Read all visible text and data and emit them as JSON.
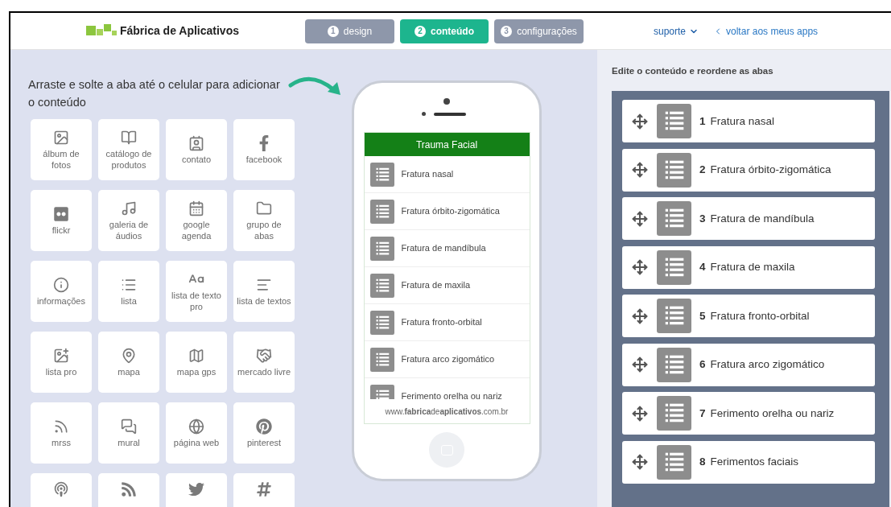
{
  "header": {
    "brand": "Fábrica de Aplicativos",
    "steps": [
      {
        "number": "1",
        "label": "design",
        "selected": false
      },
      {
        "number": "2",
        "label": "conteúdo",
        "selected": true
      },
      {
        "number": "3",
        "label": "configurações",
        "selected": false
      }
    ],
    "support": "suporte",
    "back_link": "voltar aos meus apps"
  },
  "instructions": "Arraste e solte a aba até o celular para adicionar o conteúdo",
  "tiles": [
    {
      "label": "álbum de fotos"
    },
    {
      "label": "catálogo de produtos"
    },
    {
      "label": "contato"
    },
    {
      "label": "facebook"
    },
    {
      "label": "flickr"
    },
    {
      "label": "galeria de áudios"
    },
    {
      "label": "google agenda"
    },
    {
      "label": "grupo de abas"
    },
    {
      "label": "informações"
    },
    {
      "label": "lista"
    },
    {
      "label": "lista de texto pro"
    },
    {
      "label": "lista de textos"
    },
    {
      "label": "lista pro"
    },
    {
      "label": "mapa"
    },
    {
      "label": "mapa gps"
    },
    {
      "label": "mercado livre"
    },
    {
      "label": "mrss"
    },
    {
      "label": "mural"
    },
    {
      "label": "página web"
    },
    {
      "label": "pinterest"
    }
  ],
  "phone": {
    "title": "Trauma Facial",
    "items": [
      "Fratura nasal",
      "Fratura órbito-zigomática",
      "Fratura de mandíbula",
      "Fratura de maxila",
      "Fratura fronto-orbital",
      "Fratura arco zigomático",
      "Ferimento orelha ou nariz"
    ],
    "footer": "www.**fabrica**de**aplicativos**.com.br"
  },
  "editor": {
    "title": "Edite o conteúdo e reordene as abas",
    "tabs": [
      {
        "number": "1",
        "label": "Fratura nasal"
      },
      {
        "number": "2",
        "label": "Fratura órbito-zigomática"
      },
      {
        "number": "3",
        "label": "Fratura de mandíbula"
      },
      {
        "number": "4",
        "label": "Fratura de maxila"
      },
      {
        "number": "5",
        "label": "Fratura fronto-orbital"
      },
      {
        "number": "6",
        "label": "Fratura arco zigomático"
      },
      {
        "number": "7",
        "label": "Ferimento orelha ou nariz"
      },
      {
        "number": "8",
        "label": "Ferimentos faciais"
      }
    ]
  }
}
